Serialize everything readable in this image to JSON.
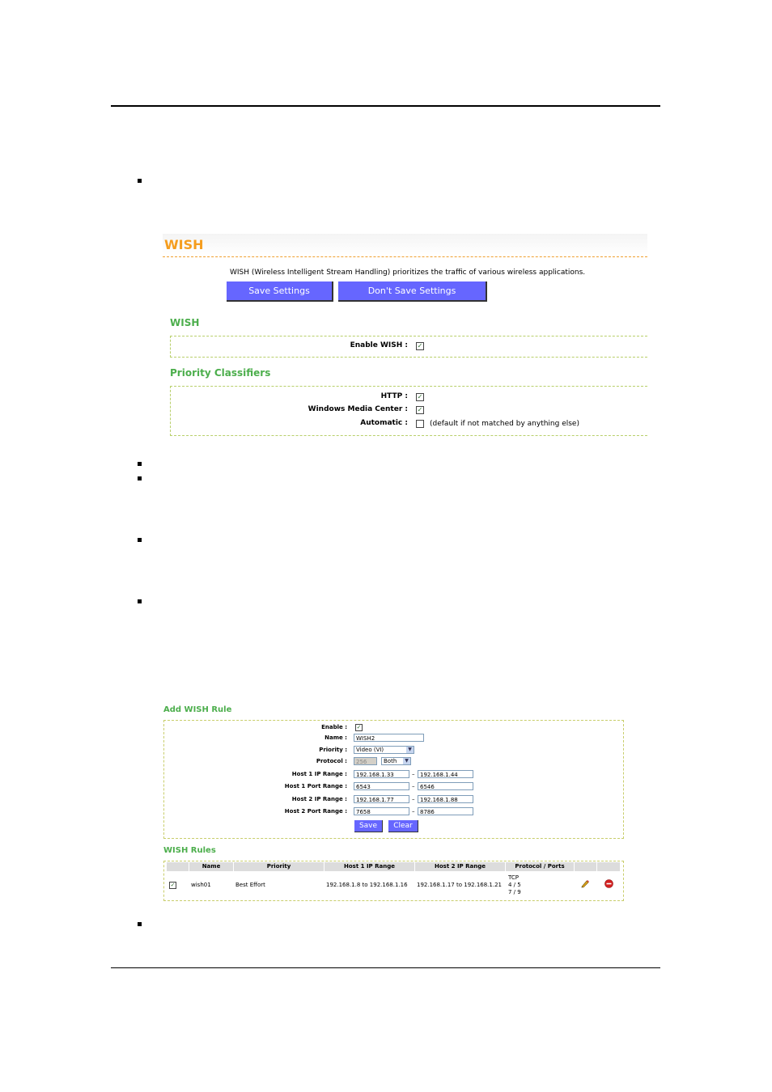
{
  "wish_page": {
    "title": "WISH",
    "description": "WISH (Wireless Intelligent Stream Handling) prioritizes the traffic of various wireless applications.",
    "save_button": "Save Settings",
    "dont_save_button": "Don't Save Settings",
    "wish_section_title": "WISH",
    "enable_wish_label": "Enable WISH :",
    "priority_title": "Priority Classifiers",
    "http_label": "HTTP :",
    "wmc_label": "Windows Media Center :",
    "automatic_label": "Automatic :",
    "automatic_note": "(default if not matched by anything else)",
    "enable_wish_checked": true,
    "http_checked": true,
    "wmc_checked": true,
    "automatic_checked": false
  },
  "add_rule": {
    "title": "Add WISH Rule",
    "enable_label": "Enable :",
    "enable_checked": true,
    "name_label": "Name :",
    "name_value": "WISH2",
    "priority_label": "Priority :",
    "priority_value": "Video (VI)",
    "protocol_label": "Protocol :",
    "protocol_number": "256",
    "protocol_value": "Both",
    "host1_ip_label": "Host 1 IP Range :",
    "host1_ip_start": "192.168.1.33",
    "host1_ip_end": "192.168.1.44",
    "host1_port_label": "Host 1 Port Range :",
    "host1_port_start": "6543",
    "host1_port_end": "6546",
    "host2_ip_label": "Host 2 IP Range :",
    "host2_ip_start": "192.168.1.77",
    "host2_ip_end": "192.168.1.88",
    "host2_port_label": "Host 2 Port Range :",
    "host2_port_start": "7658",
    "host2_port_end": "8786",
    "range_separator": "–",
    "save_button": "Save",
    "clear_button": "Clear"
  },
  "rules": {
    "title": "WISH Rules",
    "headers": [
      "Name",
      "Priority",
      "Host 1 IP Range",
      "Host 2 IP Range",
      "Protocol / Ports"
    ],
    "rows": [
      {
        "checked": true,
        "name": "wish01",
        "priority": "Best Effort",
        "host1": "192.168.1.8 to 192.168.1.16",
        "host2": "192.168.1.17 to 192.168.1.21",
        "protocol": "TCP",
        "ports1": "4 / 5",
        "ports2": "7 / 9",
        "edit_icon": "pencil-icon",
        "delete_icon": "delete-icon"
      }
    ]
  }
}
